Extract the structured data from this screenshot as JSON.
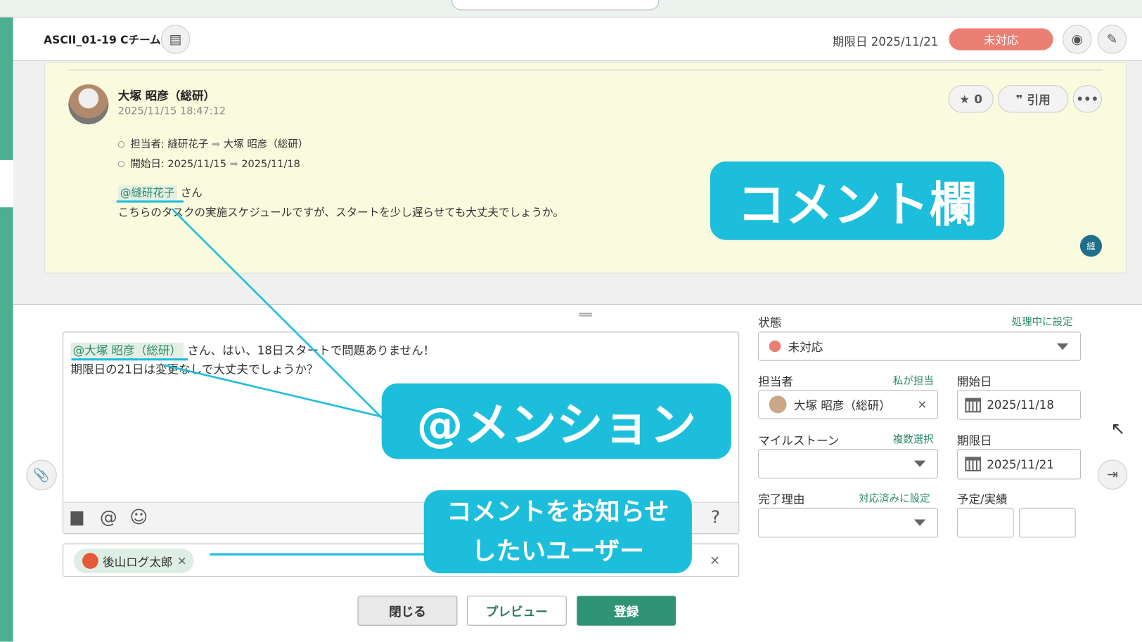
{
  "header": {
    "title": "ASCII_01-19 Cチーム",
    "due_label": "期限日 2025/11/21",
    "status": "未対応"
  },
  "comment": {
    "author": "大塚 昭彦（総研）",
    "timestamp": "2025/11/15 18:47:12",
    "changes": [
      {
        "text": "担当者: 縫研花子",
        "arrow": "➡",
        "to": "大塚 昭彦（総研）"
      },
      {
        "text": "開始日: 2025/11/15",
        "arrow": "➡",
        "to": "2025/11/18"
      }
    ],
    "mention": "@縫研花子",
    "mention_suffix": " さん",
    "body": "こちらのタスクの実施スケジュールですが、スタートを少し遅らせても大丈夫でしょうか。",
    "star_count": "0",
    "quote_label": "引用",
    "reader_badge": "縫"
  },
  "callouts": {
    "comment": "コメント欄",
    "mention": "@メンション",
    "notify_line1": "コメントをお知らせ",
    "notify_line2": "したいユーザー"
  },
  "editor": {
    "mention": "@大塚 昭彦（総研）",
    "line1_rest": " さん、はい、18日スタートで問題ありません！",
    "line2": "期限日の21日は変更なしで大丈夫でしょうか？",
    "help": "?"
  },
  "notify": {
    "users": [
      {
        "name": "後山ログ太郎"
      }
    ],
    "clear": "×"
  },
  "buttons": {
    "close": "閉じる",
    "preview": "プレビュー",
    "submit": "登録"
  },
  "form": {
    "status": {
      "label": "状態",
      "link": "処理中に設定",
      "value": "未対応",
      "color": "#ec7f73"
    },
    "assignee": {
      "label": "担当者",
      "link": "私が担当",
      "value": "大塚 昭彦（総研）"
    },
    "start": {
      "label": "開始日",
      "value": "2025/11/18"
    },
    "milestone": {
      "label": "マイルストーン",
      "link": "複数選択",
      "value": ""
    },
    "due": {
      "label": "期限日",
      "value": "2025/11/21"
    },
    "resolution": {
      "label": "完了理由",
      "link": "対応済みに設定",
      "value": ""
    },
    "hours": {
      "label": "予定/実績",
      "estimated": "",
      "actual": ""
    }
  }
}
